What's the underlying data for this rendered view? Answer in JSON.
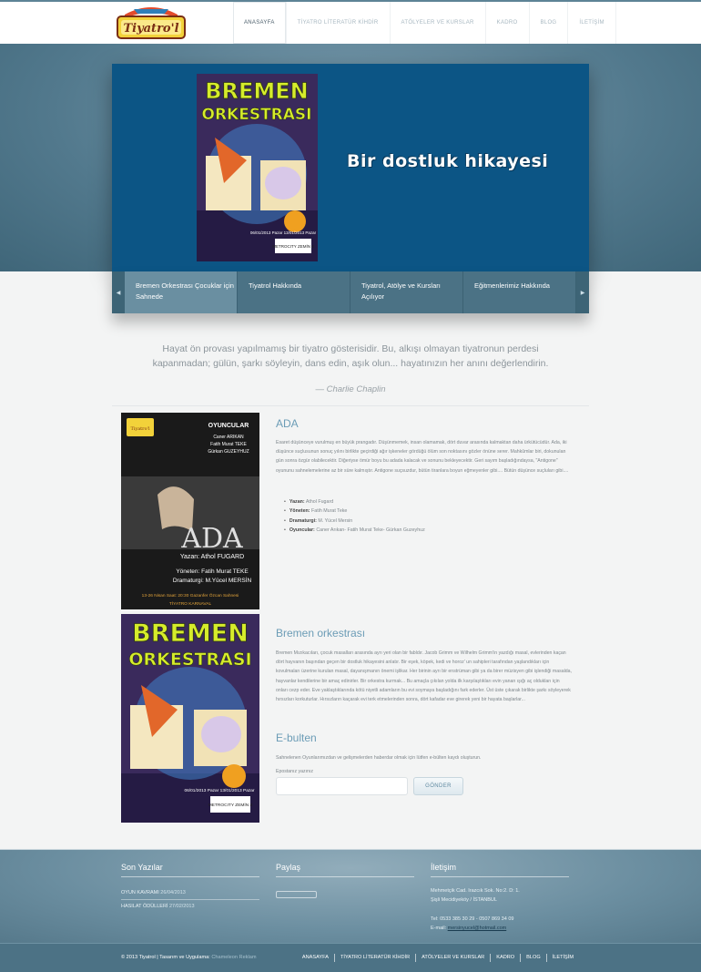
{
  "brand": {
    "logo_text": "Tiyatro'l"
  },
  "nav": [
    "ANASAYFA",
    "TİYATRO LİTERATÜR KİHDİR",
    "ATÖLYELER VE KURSLAR",
    "KADRO",
    "BLOG",
    "İLETİŞİM"
  ],
  "hero": {
    "slide_title": "Bir dostluk hikayesi",
    "poster": {
      "title_line1": "BREMEN",
      "title_line2": "ORKESTRASI",
      "dates": "06/01/2013 Pazar 13/01/2013 Pazar",
      "venue": "METROCITY ZEMİN 4"
    }
  },
  "tabs": [
    "Bremen Orkestrası Çocuklar için Sahnede",
    "Tiyatrol Hakkında",
    "Tiyatrol, Atölye ve Kursları Açılıyor",
    "Eğitmenlerimiz Hakkında"
  ],
  "quote": {
    "text": "Hayat ön provası yapılmamış bir tiyatro gösterisidir. Bu, alkışı olmayan tiyatronun perdesi kapanmadan; gülün, şarkı söyleyin, dans edin, aşık olun... hayatınızın her anını değerlendirin.",
    "author": "— Charlie Chaplin"
  },
  "ada": {
    "title": "ADA",
    "text": "Esaret düşünceye vurulmuş en büyük prangadır. Düşünmemek, insan olamamak, dört duvar arasında kalmaktan daha ürkütücüdür. Ada, iki düşünce suçlusunun sonuç yılını birlikte geçirdiği ağır işkeneler gördüğü ölüm son noktasını gözler önüne serer. Mahkûmlar biri, dokunulan gün sonra özgür olabilecektir. Diğeriyse ömür boyu bu adada kalacak ve sonunu bekleyecektir. Geri sayım başladığındaysa, \"Antigone\" oyununu sahnelemelerine az bir süre kalmıştır. Antigone suçsuzdur, bütün tiranlara boyun eğmeyenler gibi.... Bütün düşünce suçluları gibi....",
    "facts": [
      {
        "label": "Yazan:",
        "value": "Athol Fugard"
      },
      {
        "label": "Yöneten:",
        "value": "Fatih Murat Teke"
      },
      {
        "label": "Dramaturgi:",
        "value": "M. Yücel Mersin"
      },
      {
        "label": "Oyuncular:",
        "value": "Caner Arıkan- Fatih Murat Teke- Gürkan Guzeyhuz"
      }
    ],
    "poster": {
      "badge": "OYUNCULAR",
      "cast": [
        "Caner ARIKAN",
        "Fatih Murat TEKE",
        "Gürkan GUZEYHUZ"
      ],
      "title": "ADA",
      "author": "Yazan: Athol FUGARD",
      "director": "Yöneten: Fatih Murat TEKE",
      "dramaturg": "Dramaturgi: M.Yücel MERSİN",
      "date": "13-26 Nisan  Saat: 20:30  Gazanfer Özcan Sahnesi",
      "venue": "TİYATRO KARNAVAL"
    }
  },
  "bremen": {
    "title": "Bremen orkestrası",
    "text": "Bremen Mızıkacıları, çocuk masalları arasında ayrı yeri olan bir fabldır. Jacob Grimm ve Wilhelm Grimm'in yazdığı masal, evlerinden kaçan dört hayvanın başından geçen bir dostluk hikayesini anlatır. Bir eşek, köpek, kedi ve horoz' un sahipleri tarafından yaşlandıkları için kovulmaları üzerine kurulan masal, dayanışmanın önemi işlikar. Her birinin ayrı bir enstrüman gibi ya da birer müzisyen gibi işlendiği masalda, hayvanlar kendilerine bir amaç edinirler. Bir orkestra kurmak... Bu amaçla çıkılan yolda ilk karşılaştıkları evin yanan ışığı aç oldukları için onları cezp eder. Eve yaklaştıklarında kötü niyetli adamların bu evi soymaya başladığını fark ederler. Üst üste çıkarak birlikte şarkı söyleyerek hırsızları korkuturlar. Hırsızların kaçarak evi terk etmelerinden sonra, dört kafadar eve girerek yeni bir hayata başlarlar..."
  },
  "ebulten": {
    "title": "E-bulten",
    "text": "Sahnelenen Oyunlarımızdan ve gelişmelerden haberdar olmak için lütfen e-bülten kaydı oluşturun.",
    "label": "Epostanız yazınız",
    "button": "GÖNDER"
  },
  "footer": {
    "recent_title": "Son Yazılar",
    "recent": [
      {
        "title": "OYUN KAVRAMI",
        "date": "26/04/2013"
      },
      {
        "title": "HASILAT ÖDÜLLERİ",
        "date": "27/02/2013"
      }
    ],
    "share_title": "Paylaş",
    "contact_title": "İletişim",
    "address1": "Mehmetçik Cad. Irazcık Sok. No:2. D: 1.",
    "address2": "Şişli Mecidiyeköy / İSTANBUL",
    "phone": "Tel: 0533 385 30 29 - 0507 869 34 09",
    "email_label": "E-mail:",
    "email": "mersinyucel@hotmail.com",
    "copyright": "© 2013 Tiyatrol | Tasarım ve Uygulama:",
    "designer": "Chameleon Reklam"
  },
  "colors": {
    "accent": "#6b9cb6",
    "band": "#52798d",
    "slide_bg": "#0c5585"
  }
}
